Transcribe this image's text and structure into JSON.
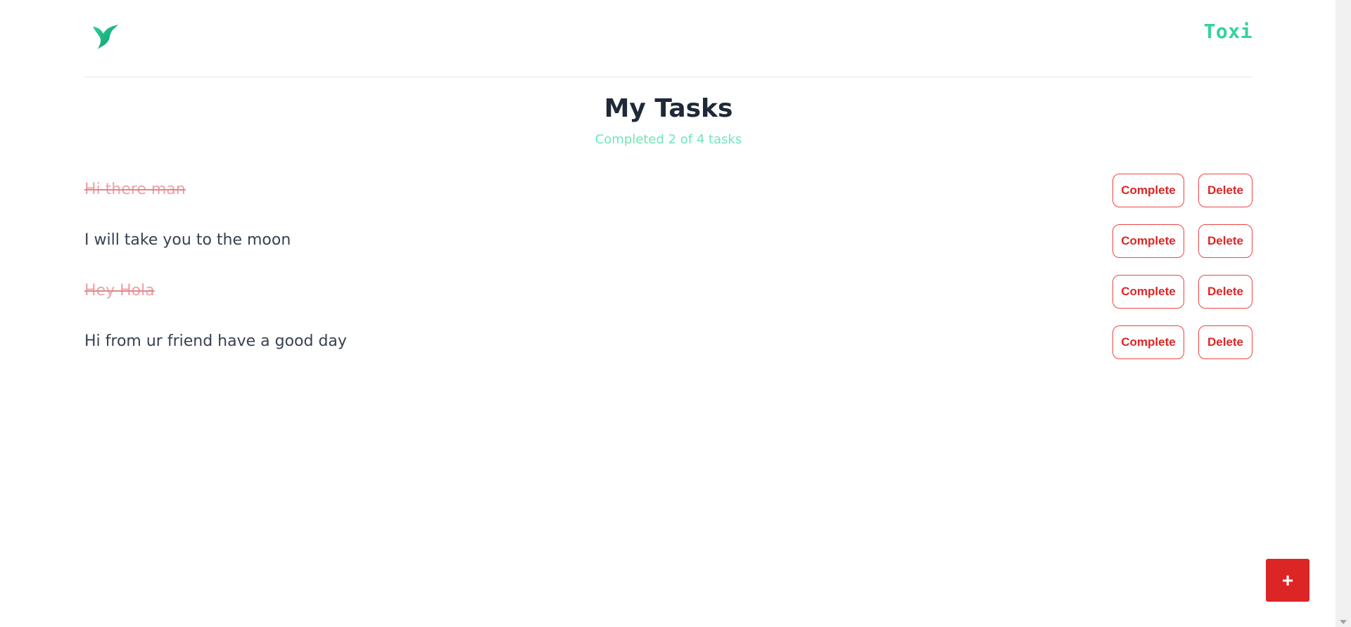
{
  "header": {
    "brand": "Toxi"
  },
  "page": {
    "title": "My Tasks",
    "subtitle": "Completed 2 of 4 tasks"
  },
  "tasks": [
    {
      "text": "Hi there man",
      "completed": true,
      "complete_label": "Complete",
      "delete_label": "Delete"
    },
    {
      "text": "I will take you to the moon",
      "completed": false,
      "complete_label": "Complete",
      "delete_label": "Delete"
    },
    {
      "text": "Hey Hola",
      "completed": true,
      "complete_label": "Complete",
      "delete_label": "Delete"
    },
    {
      "text": "Hi from ur friend have a good day",
      "completed": false,
      "complete_label": "Complete",
      "delete_label": "Delete"
    }
  ],
  "fab": {
    "label": "+"
  },
  "icons": {
    "logo": "hummingbird-logo-icon"
  },
  "colors": {
    "brand": "#34d399",
    "accent": "#dc2626",
    "subtitle": "#6ee7b7",
    "completed_text": "#f0a0a6"
  }
}
